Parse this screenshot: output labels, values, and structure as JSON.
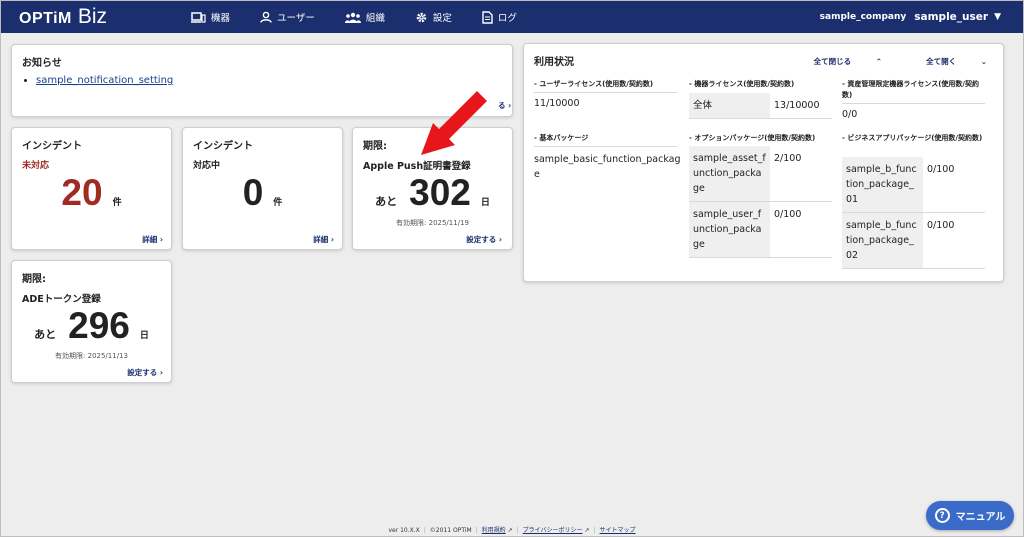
{
  "header": {
    "logo_optim": "OPTiM",
    "logo_biz": "Biz",
    "nav": [
      {
        "label": "機器",
        "icon": "device-icon"
      },
      {
        "label": "ユーザー",
        "icon": "user-icon"
      },
      {
        "label": "組織",
        "icon": "organization-icon"
      },
      {
        "label": "設定",
        "icon": "gear-icon"
      },
      {
        "label": "ログ",
        "icon": "log-icon"
      }
    ],
    "company": "sample_company",
    "user": "sample_user"
  },
  "notice": {
    "title": "お知らせ",
    "items": [
      "sample_notification_setting"
    ],
    "more_label": "る"
  },
  "incident_unhandled": {
    "title": "インシデント",
    "status": "未対応",
    "count": "20",
    "unit": "件",
    "link": "詳細"
  },
  "incident_handling": {
    "title": "インシデント",
    "status": "対応中",
    "count": "0",
    "unit": "件",
    "link": "詳細"
  },
  "apple_push": {
    "title": "期限:",
    "name": "Apple Push証明書登録",
    "prefix": "あと",
    "days": "302",
    "unit": "日",
    "expiry": "有効期限: 2025/11/19",
    "link": "設定する"
  },
  "ade_token": {
    "title": "期限:",
    "name": "ADEトークン登録",
    "prefix": "あと",
    "days": "296",
    "unit": "日",
    "expiry": "有効期限: 2025/11/13",
    "link": "設定する"
  },
  "usage": {
    "title": "利用状況",
    "collapse_all": "全て閉じる",
    "expand_all": "全て開く",
    "user_license": {
      "heading": "ユーザーライセンス(使用数/契約数)",
      "value": "11/10000"
    },
    "device_license": {
      "heading": "機器ライセンス(使用数/契約数)",
      "rows": [
        {
          "name": "全体",
          "value": "13/10000"
        }
      ]
    },
    "asset_license": {
      "heading": "資産管理限定機器ライセンス(使用数/契約数)",
      "value": "0/0"
    },
    "basic_package": {
      "heading": "基本パッケージ",
      "value": "sample_basic_function_package"
    },
    "option_package": {
      "heading": "オプションパッケージ(使用数/契約数)",
      "rows": [
        {
          "name": "sample_asset_function_package",
          "value": "2/100"
        },
        {
          "name": "sample_user_function_package",
          "value": "0/100"
        }
      ]
    },
    "business_package": {
      "heading": "ビジネスアプリパッケージ(使用数/契約数)",
      "rows": [
        {
          "name": "sample_b_function_package_01",
          "value": "0/100"
        },
        {
          "name": "sample_b_function_package_02",
          "value": "0/100"
        }
      ]
    }
  },
  "footer": {
    "version": "ver 10.X.X",
    "copyright": "©2011 OPTiM",
    "terms": "利用規約",
    "privacy": "プライバシーポリシー",
    "sitemap": "サイトマップ"
  },
  "manual_button": "マニュアル",
  "colors": {
    "header_bg": "#1b2f6e",
    "danger": "#a02a24",
    "annotation_arrow": "#e8161b",
    "manual_btn": "#3a6bc9"
  }
}
